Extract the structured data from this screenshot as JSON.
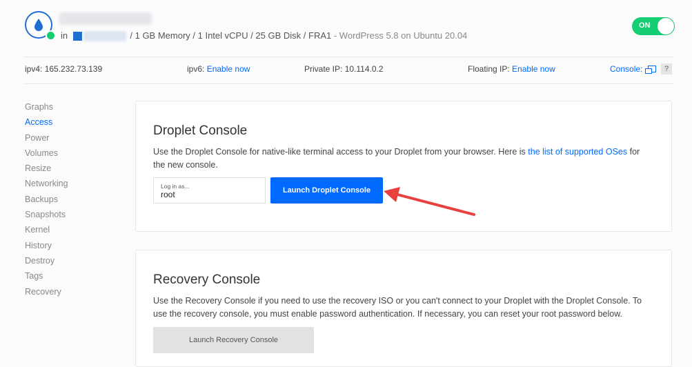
{
  "header": {
    "meta_prefix": "in",
    "meta_specs": "/ 1 GB Memory / 1 Intel vCPU / 25 GB Disk / FRA1",
    "meta_image": "- WordPress 5.8 on Ubuntu 20.04",
    "power_toggle": {
      "label": "ON",
      "state": "on",
      "color": "#15cd72"
    },
    "status_color": "#15cd72"
  },
  "ipbar": {
    "ipv4_label": "ipv4:",
    "ipv4_value": "165.232.73.139",
    "ipv6_label": "ipv6:",
    "ipv6_link": "Enable now",
    "private_label": "Private IP:",
    "private_value": "10.114.0.2",
    "floating_label": "Floating IP:",
    "floating_link": "Enable now",
    "console_link": "Console:",
    "help": "?"
  },
  "sidebar": {
    "items": [
      {
        "label": "Graphs",
        "active": false
      },
      {
        "label": "Access",
        "active": true
      },
      {
        "label": "Power",
        "active": false
      },
      {
        "label": "Volumes",
        "active": false
      },
      {
        "label": "Resize",
        "active": false
      },
      {
        "label": "Networking",
        "active": false
      },
      {
        "label": "Backups",
        "active": false
      },
      {
        "label": "Snapshots",
        "active": false
      },
      {
        "label": "Kernel",
        "active": false
      },
      {
        "label": "History",
        "active": false
      },
      {
        "label": "Destroy",
        "active": false
      },
      {
        "label": "Tags",
        "active": false
      },
      {
        "label": "Recovery",
        "active": false
      }
    ]
  },
  "droplet_console": {
    "title": "Droplet Console",
    "desc_before": "Use the Droplet Console for native-like terminal access to your Droplet from your browser. Here is",
    "desc_link": "the list of supported OSes",
    "desc_after": "for the new console.",
    "login_label": "Log in as...",
    "login_value": "root",
    "launch_label": "Launch Droplet Console"
  },
  "recovery_console": {
    "title": "Recovery Console",
    "desc": "Use the Recovery Console if you need to use the recovery ISO or you can't connect to your Droplet with the Droplet Console. To use the recovery console, you must enable password authentication. If necessary, you can reset your root password below.",
    "launch_label": "Launch Recovery Console"
  },
  "colors": {
    "accent": "#0069ff",
    "annotation_arrow": "#e8403c"
  }
}
